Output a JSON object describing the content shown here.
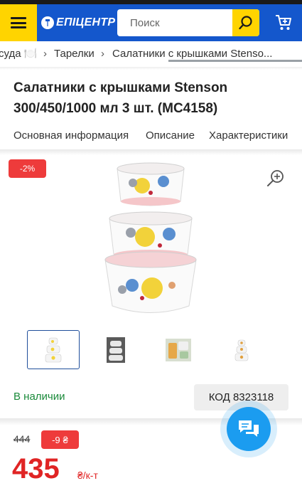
{
  "header": {
    "logo_text": "ЕПІЦЕНТР",
    "search_placeholder": "Поиск"
  },
  "breadcrumb": {
    "items": [
      "суда 🍽️",
      "Тарелки",
      "Салатники с крышками Stenso..."
    ]
  },
  "product": {
    "title": "Салатники с крышками Stenson 300/450/1000 мл 3 шт. (MC4158)",
    "discount_badge": "-2%",
    "availability": "В наличии",
    "code_label": "КОД 8323118",
    "old_price": "444",
    "price_diff": "-9",
    "price_diff_currency": "₴",
    "price": "435",
    "unit": "₴/к-т"
  },
  "tabs": [
    "Основная информация",
    "Описание",
    "Характеристики"
  ],
  "icons": [
    "menu-icon",
    "logo-icon",
    "search-icon",
    "cart-icon",
    "zoom-in-icon",
    "chat-icon"
  ],
  "colors": {
    "header_blue": "#1457cc",
    "accent_yellow": "#ffd400",
    "price_red": "#e02424",
    "badge_red": "#ee3b3b",
    "stock_green": "#1a8a3a",
    "chat_blue": "#1b9cf0"
  }
}
